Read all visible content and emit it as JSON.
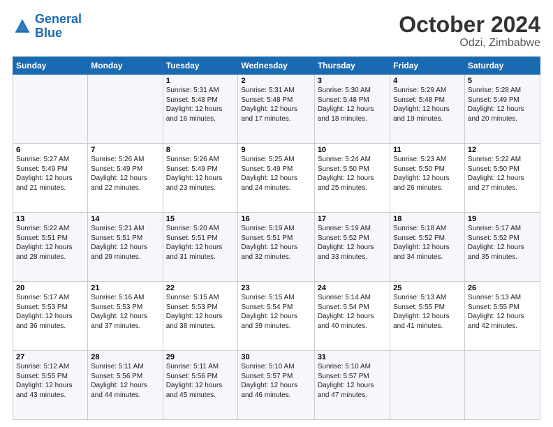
{
  "header": {
    "logo_line1": "General",
    "logo_line2": "Blue",
    "title": "October 2024",
    "subtitle": "Odzi, Zimbabwe"
  },
  "weekdays": [
    "Sunday",
    "Monday",
    "Tuesday",
    "Wednesday",
    "Thursday",
    "Friday",
    "Saturday"
  ],
  "rows": [
    [
      {
        "day": "",
        "info": ""
      },
      {
        "day": "",
        "info": ""
      },
      {
        "day": "1",
        "info": "Sunrise: 5:31 AM\nSunset: 5:48 PM\nDaylight: 12 hours\nand 16 minutes."
      },
      {
        "day": "2",
        "info": "Sunrise: 5:31 AM\nSunset: 5:48 PM\nDaylight: 12 hours\nand 17 minutes."
      },
      {
        "day": "3",
        "info": "Sunrise: 5:30 AM\nSunset: 5:48 PM\nDaylight: 12 hours\nand 18 minutes."
      },
      {
        "day": "4",
        "info": "Sunrise: 5:29 AM\nSunset: 5:48 PM\nDaylight: 12 hours\nand 19 minutes."
      },
      {
        "day": "5",
        "info": "Sunrise: 5:28 AM\nSunset: 5:49 PM\nDaylight: 12 hours\nand 20 minutes."
      }
    ],
    [
      {
        "day": "6",
        "info": "Sunrise: 5:27 AM\nSunset: 5:49 PM\nDaylight: 12 hours\nand 21 minutes."
      },
      {
        "day": "7",
        "info": "Sunrise: 5:26 AM\nSunset: 5:49 PM\nDaylight: 12 hours\nand 22 minutes."
      },
      {
        "day": "8",
        "info": "Sunrise: 5:26 AM\nSunset: 5:49 PM\nDaylight: 12 hours\nand 23 minutes."
      },
      {
        "day": "9",
        "info": "Sunrise: 5:25 AM\nSunset: 5:49 PM\nDaylight: 12 hours\nand 24 minutes."
      },
      {
        "day": "10",
        "info": "Sunrise: 5:24 AM\nSunset: 5:50 PM\nDaylight: 12 hours\nand 25 minutes."
      },
      {
        "day": "11",
        "info": "Sunrise: 5:23 AM\nSunset: 5:50 PM\nDaylight: 12 hours\nand 26 minutes."
      },
      {
        "day": "12",
        "info": "Sunrise: 5:22 AM\nSunset: 5:50 PM\nDaylight: 12 hours\nand 27 minutes."
      }
    ],
    [
      {
        "day": "13",
        "info": "Sunrise: 5:22 AM\nSunset: 5:51 PM\nDaylight: 12 hours\nand 28 minutes."
      },
      {
        "day": "14",
        "info": "Sunrise: 5:21 AM\nSunset: 5:51 PM\nDaylight: 12 hours\nand 29 minutes."
      },
      {
        "day": "15",
        "info": "Sunrise: 5:20 AM\nSunset: 5:51 PM\nDaylight: 12 hours\nand 31 minutes."
      },
      {
        "day": "16",
        "info": "Sunrise: 5:19 AM\nSunset: 5:51 PM\nDaylight: 12 hours\nand 32 minutes."
      },
      {
        "day": "17",
        "info": "Sunrise: 5:19 AM\nSunset: 5:52 PM\nDaylight: 12 hours\nand 33 minutes."
      },
      {
        "day": "18",
        "info": "Sunrise: 5:18 AM\nSunset: 5:52 PM\nDaylight: 12 hours\nand 34 minutes."
      },
      {
        "day": "19",
        "info": "Sunrise: 5:17 AM\nSunset: 5:52 PM\nDaylight: 12 hours\nand 35 minutes."
      }
    ],
    [
      {
        "day": "20",
        "info": "Sunrise: 5:17 AM\nSunset: 5:53 PM\nDaylight: 12 hours\nand 36 minutes."
      },
      {
        "day": "21",
        "info": "Sunrise: 5:16 AM\nSunset: 5:53 PM\nDaylight: 12 hours\nand 37 minutes."
      },
      {
        "day": "22",
        "info": "Sunrise: 5:15 AM\nSunset: 5:53 PM\nDaylight: 12 hours\nand 38 minutes."
      },
      {
        "day": "23",
        "info": "Sunrise: 5:15 AM\nSunset: 5:54 PM\nDaylight: 12 hours\nand 39 minutes."
      },
      {
        "day": "24",
        "info": "Sunrise: 5:14 AM\nSunset: 5:54 PM\nDaylight: 12 hours\nand 40 minutes."
      },
      {
        "day": "25",
        "info": "Sunrise: 5:13 AM\nSunset: 5:55 PM\nDaylight: 12 hours\nand 41 minutes."
      },
      {
        "day": "26",
        "info": "Sunrise: 5:13 AM\nSunset: 5:55 PM\nDaylight: 12 hours\nand 42 minutes."
      }
    ],
    [
      {
        "day": "27",
        "info": "Sunrise: 5:12 AM\nSunset: 5:55 PM\nDaylight: 12 hours\nand 43 minutes."
      },
      {
        "day": "28",
        "info": "Sunrise: 5:11 AM\nSunset: 5:56 PM\nDaylight: 12 hours\nand 44 minutes."
      },
      {
        "day": "29",
        "info": "Sunrise: 5:11 AM\nSunset: 5:56 PM\nDaylight: 12 hours\nand 45 minutes."
      },
      {
        "day": "30",
        "info": "Sunrise: 5:10 AM\nSunset: 5:57 PM\nDaylight: 12 hours\nand 46 minutes."
      },
      {
        "day": "31",
        "info": "Sunrise: 5:10 AM\nSunset: 5:57 PM\nDaylight: 12 hours\nand 47 minutes."
      },
      {
        "day": "",
        "info": ""
      },
      {
        "day": "",
        "info": ""
      }
    ]
  ]
}
